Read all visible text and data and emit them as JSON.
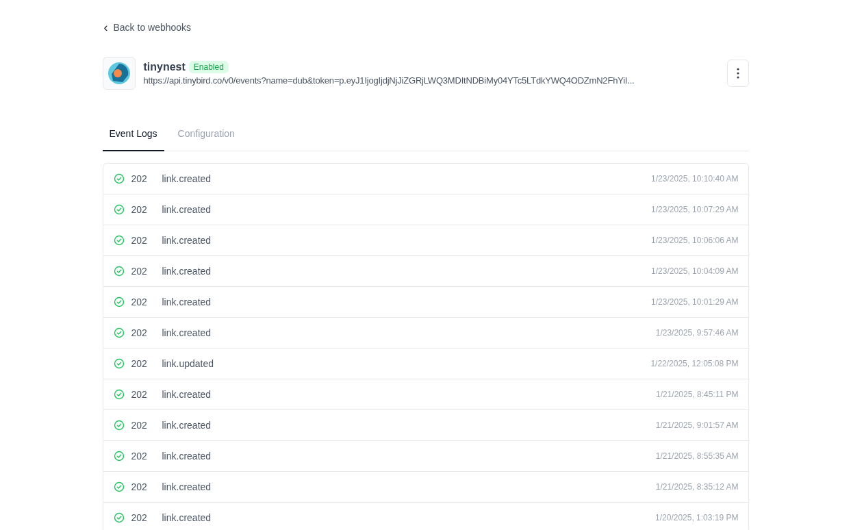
{
  "back_link": {
    "icon": "‹",
    "label": "Back to webhooks"
  },
  "webhook": {
    "name": "tinynest",
    "status": {
      "label": "Enabled",
      "enabled": true
    },
    "url": "https://api.tinybird.co/v0/events?name=dub&token=p.eyJ1IjogIjdjNjJiZGRjLWQ3MDItNDBiMy04YTc5LTdkYWQ4ODZmN2FhYiI..."
  },
  "tabs": [
    {
      "label": "Event Logs",
      "selected": true
    },
    {
      "label": "Configuration",
      "selected": false
    }
  ],
  "events": [
    {
      "success": true,
      "code": "202",
      "event": "link.created",
      "time": "1/23/2025, 10:10:40 AM"
    },
    {
      "success": true,
      "code": "202",
      "event": "link.created",
      "time": "1/23/2025, 10:07:29 AM"
    },
    {
      "success": true,
      "code": "202",
      "event": "link.created",
      "time": "1/23/2025, 10:06:06 AM"
    },
    {
      "success": true,
      "code": "202",
      "event": "link.created",
      "time": "1/23/2025, 10:04:09 AM"
    },
    {
      "success": true,
      "code": "202",
      "event": "link.created",
      "time": "1/23/2025, 10:01:29 AM"
    },
    {
      "success": true,
      "code": "202",
      "event": "link.created",
      "time": "1/23/2025, 9:57:46 AM"
    },
    {
      "success": true,
      "code": "202",
      "event": "link.updated",
      "time": "1/22/2025, 12:05:08 PM"
    },
    {
      "success": true,
      "code": "202",
      "event": "link.created",
      "time": "1/21/2025, 8:45:11 PM"
    },
    {
      "success": true,
      "code": "202",
      "event": "link.created",
      "time": "1/21/2025, 9:01:57 AM"
    },
    {
      "success": true,
      "code": "202",
      "event": "link.created",
      "time": "1/21/2025, 8:55:35 AM"
    },
    {
      "success": true,
      "code": "202",
      "event": "link.created",
      "time": "1/21/2025, 8:35:12 AM"
    },
    {
      "success": true,
      "code": "202",
      "event": "link.created",
      "time": "1/20/2025, 1:03:19 PM"
    }
  ]
}
